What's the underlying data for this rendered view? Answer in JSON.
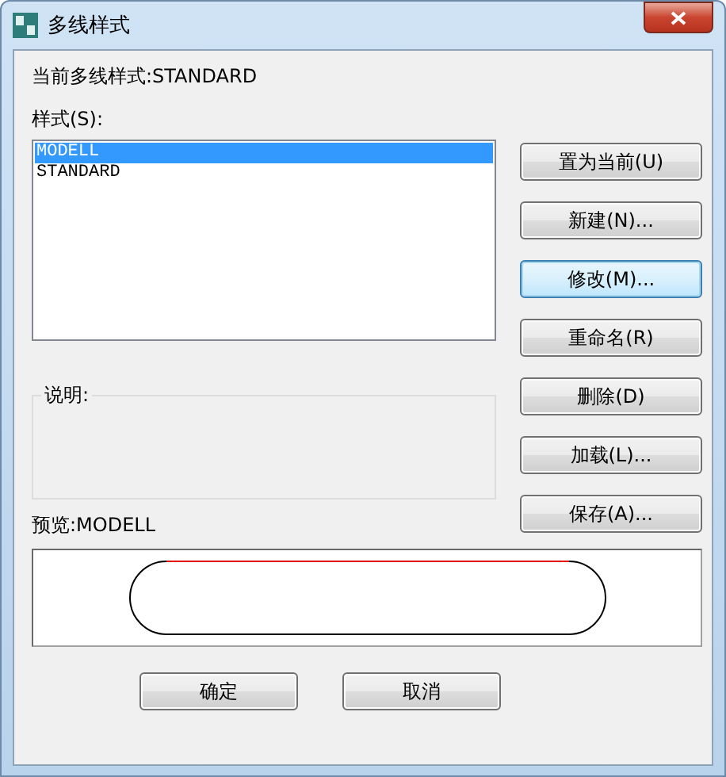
{
  "window": {
    "title": "多线样式"
  },
  "current_style": "当前多线样式:STANDARD",
  "styles_label": "样式(S):",
  "styles": [
    {
      "name": "MODELL",
      "selected": true
    },
    {
      "name": "STANDARD",
      "selected": false
    }
  ],
  "side_buttons": [
    {
      "label": "置为当前(U)",
      "focused": false
    },
    {
      "label": "新建(N)...",
      "focused": false
    },
    {
      "label": "修改(M)...",
      "focused": true
    },
    {
      "label": "重命名(R)",
      "focused": false
    },
    {
      "label": "删除(D)",
      "focused": false
    },
    {
      "label": "加载(L)...",
      "focused": false
    },
    {
      "label": "保存(A)...",
      "focused": false
    }
  ],
  "description_label": "说明:",
  "preview_label": "预览:MODELL",
  "bottom_buttons": [
    {
      "label": "确定"
    },
    {
      "label": "取消"
    }
  ]
}
